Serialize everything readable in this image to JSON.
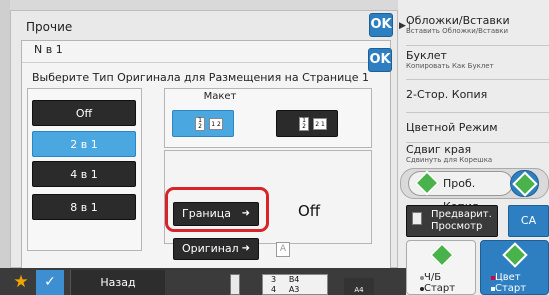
{
  "outer": {
    "title": "Прочие",
    "ok": "OK"
  },
  "inner": {
    "title": "N в 1",
    "ok": "OK",
    "prompt": "Выберите Тип Оригинала для Размещения на Странице 1"
  },
  "options": [
    {
      "label": "Off"
    },
    {
      "label": "2 в 1"
    },
    {
      "label": "4 в 1"
    },
    {
      "label": "8 в 1"
    }
  ],
  "layout": {
    "label": "Макет",
    "btn1_a": "1",
    "btn1_b": "2",
    "btn1_c": "1 2",
    "btn2_a": "1",
    "btn2_b": "2",
    "btn2_c": "2 1"
  },
  "border": {
    "button": "Граница",
    "value": "Off"
  },
  "original": {
    "button": "Оригинал",
    "icon_text": "A"
  },
  "right_menu": [
    {
      "title": "Обложки/Вставки",
      "sub": "Вставить Обложки/Вставки"
    },
    {
      "title": "Буклет",
      "sub": "Копировать Как Буклет"
    },
    {
      "title": "2-Стор. Копия",
      "sub": ""
    },
    {
      "title": "Цветной Режим",
      "sub": ""
    },
    {
      "title": "Сдвиг края",
      "sub": "Сдвинуть для Корешка"
    }
  ],
  "actions": {
    "proof_copy": "Проб. Копия",
    "preview_line1": "Предварит.",
    "preview_line2": "Просмотр",
    "ca": "CA",
    "bw_line1": "Ч/Б",
    "bw_line2": "Старт",
    "color_line1": "Цвет",
    "color_line2": "Старт"
  },
  "bottom": {
    "back": "Назад",
    "paper_rows": [
      {
        "num": "3",
        "size": "B4"
      },
      {
        "num": "4",
        "size": "A3"
      }
    ],
    "output_size": "A4"
  },
  "colors": {
    "accent": "#2d7fc1",
    "selected": "#4aa7e0",
    "highlight": "#d8232a",
    "go": "#4ab24a"
  }
}
